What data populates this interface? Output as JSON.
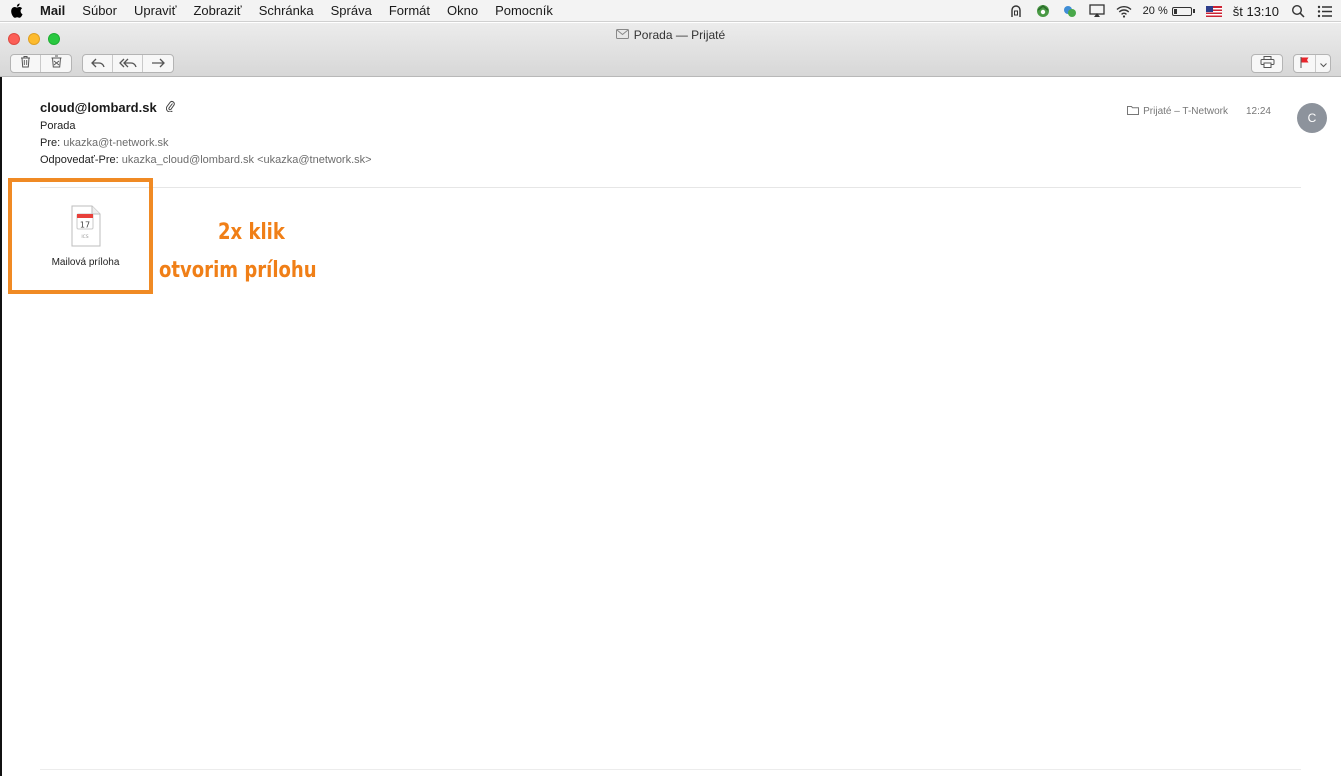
{
  "menubar": {
    "app_name": "Mail",
    "items": [
      "Súbor",
      "Upraviť",
      "Zobraziť",
      "Schránka",
      "Správa",
      "Formát",
      "Okno",
      "Pomocník"
    ],
    "status": {
      "battery_percent": "20 %",
      "clock": "št 13:10"
    }
  },
  "window": {
    "title": "Porada — Prijaté"
  },
  "toolbar": {
    "left_buttons": [
      "trash-icon",
      "junk-icon",
      "reply-icon",
      "reply-all-icon",
      "forward-icon"
    ],
    "right_buttons": [
      "print-icon",
      "flag-icon"
    ]
  },
  "message": {
    "from": "cloud@lombard.sk",
    "subject": "Porada",
    "to_label": "Pre:",
    "to_value": "ukazka@t-network.sk",
    "reply_to_label": "Odpovedať-Pre:",
    "reply_to_value": "ukazka_cloud@lombard.sk <ukazka@tnetwork.sk>",
    "mailbox": "Prijaté – T-Network",
    "time": "12:24",
    "avatar_initial": "C"
  },
  "attachment": {
    "name": "Mailová príloha",
    "calendar_day": "17",
    "file_ext": "ICS"
  },
  "annotation": {
    "line1": "2x klik",
    "line2": "otvorim prílohu",
    "color": "#f08a24"
  }
}
